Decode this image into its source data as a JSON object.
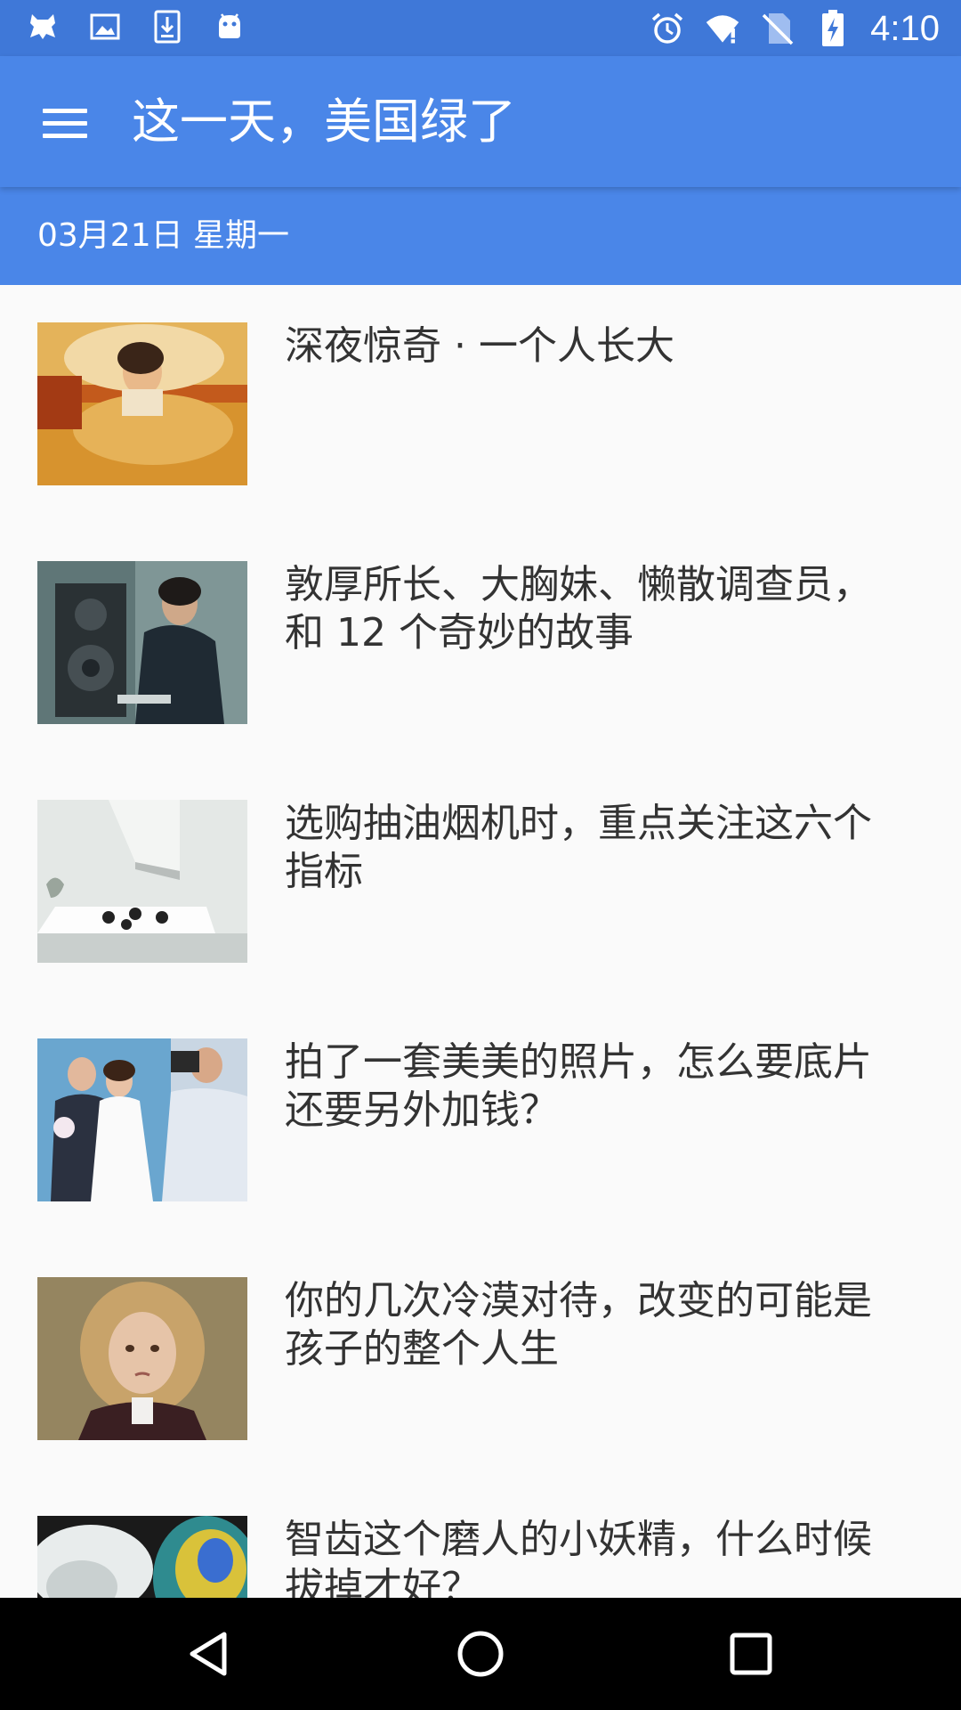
{
  "status_bar": {
    "left_icons": [
      "app-icon",
      "image-icon",
      "download-icon",
      "android-icon"
    ],
    "right_icons": [
      "alarm-icon",
      "wifi-icon",
      "no-sim-icon",
      "battery-charging-icon"
    ],
    "time": "4:10"
  },
  "toolbar": {
    "menu_icon": "menu-icon",
    "title": "这一天，美国绿了"
  },
  "date_bar": {
    "date": "03月21日 星期一"
  },
  "articles": [
    {
      "title": "深夜惊奇 · 一个人长大"
    },
    {
      "title": "敦厚所长、大胸妹、懒散调查员，和 12 个奇妙的故事"
    },
    {
      "title": "选购抽油烟机时，重点关注这六个指标"
    },
    {
      "title": "拍了一套美美的照片，怎么要底片还要另外加钱？"
    },
    {
      "title": "你的几次冷漠对待，改变的可能是孩子的整个人生"
    },
    {
      "title": "智齿这个磨人的小妖精，什么时候拔掉才好？"
    }
  ],
  "nav_bar": {
    "buttons": [
      "back-icon",
      "home-icon",
      "recents-icon"
    ]
  },
  "colors": {
    "status_bar": "#3f78d8",
    "primary": "#4a86e8",
    "background": "#fafafa",
    "title_text": "#333333"
  }
}
